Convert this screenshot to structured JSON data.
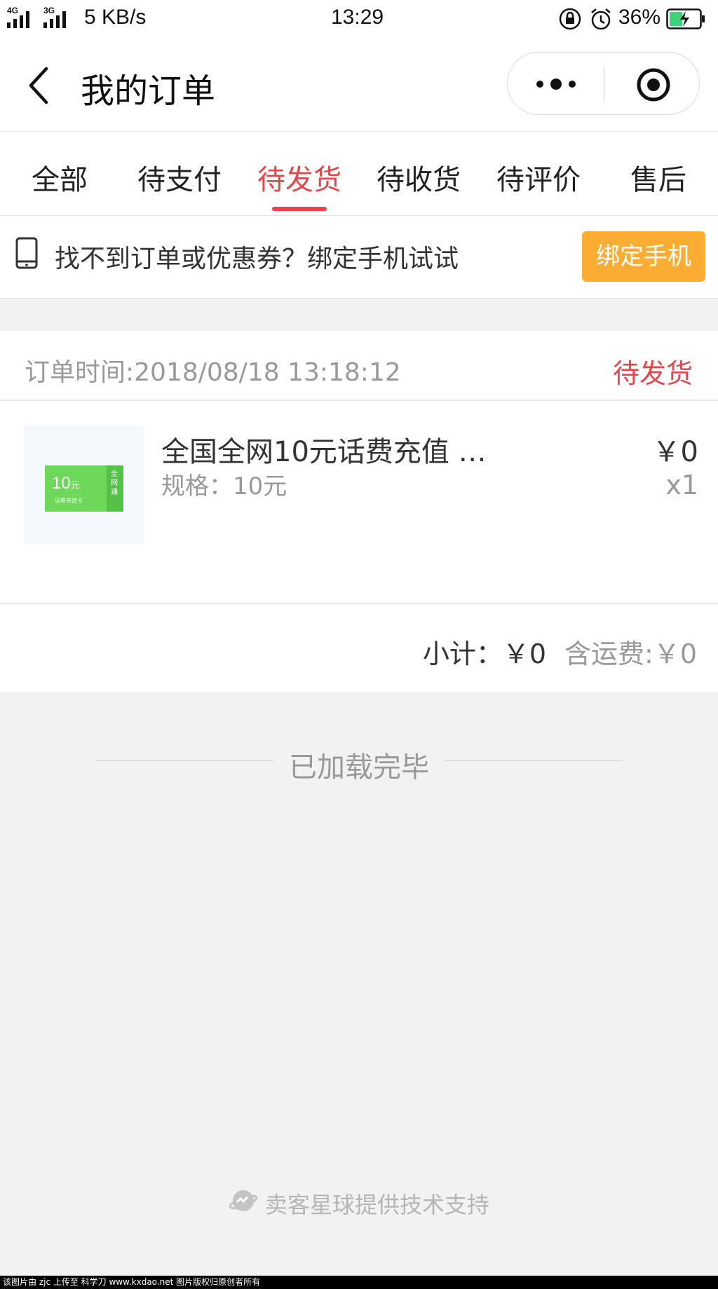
{
  "status_bar": {
    "net_label_1": "4G",
    "net_label_2": "3G",
    "speed": "5 KB/s",
    "time": "13:29",
    "battery": "36%"
  },
  "nav": {
    "title": "我的订单"
  },
  "tabs": [
    {
      "label": "全部",
      "active": false
    },
    {
      "label": "待支付",
      "active": false
    },
    {
      "label": "待发货",
      "active": true
    },
    {
      "label": "待收货",
      "active": false
    },
    {
      "label": "待评价",
      "active": false
    },
    {
      "label": "售后",
      "active": false
    }
  ],
  "banner": {
    "text": "找不到订单或优惠券？绑定手机试试",
    "button": "绑定手机"
  },
  "order": {
    "time": "订单时间:2018/08/18 13:18:12",
    "status": "待发货",
    "product": {
      "name": "全国全网10元话费充值 …",
      "spec": "规格：10元",
      "price": "￥0",
      "qty": "x1",
      "thumb_amount": "10",
      "thumb_unit": "元",
      "thumb_caption": "话费充值卡",
      "thumb_side": "全网通"
    },
    "subtotal": "小计：￥0",
    "shipping": "含运费:￥0"
  },
  "loaded_text": "已加载完毕",
  "powered_by": "卖客星球提供技术支持",
  "watermark": "该图片由 zjc 上传至 科学刀 www.kxdao.net 图片版权归原创者所有",
  "colors": {
    "accent_red": "#e5464a",
    "button_orange": "#fbad33",
    "background": "#f2f2f2"
  }
}
